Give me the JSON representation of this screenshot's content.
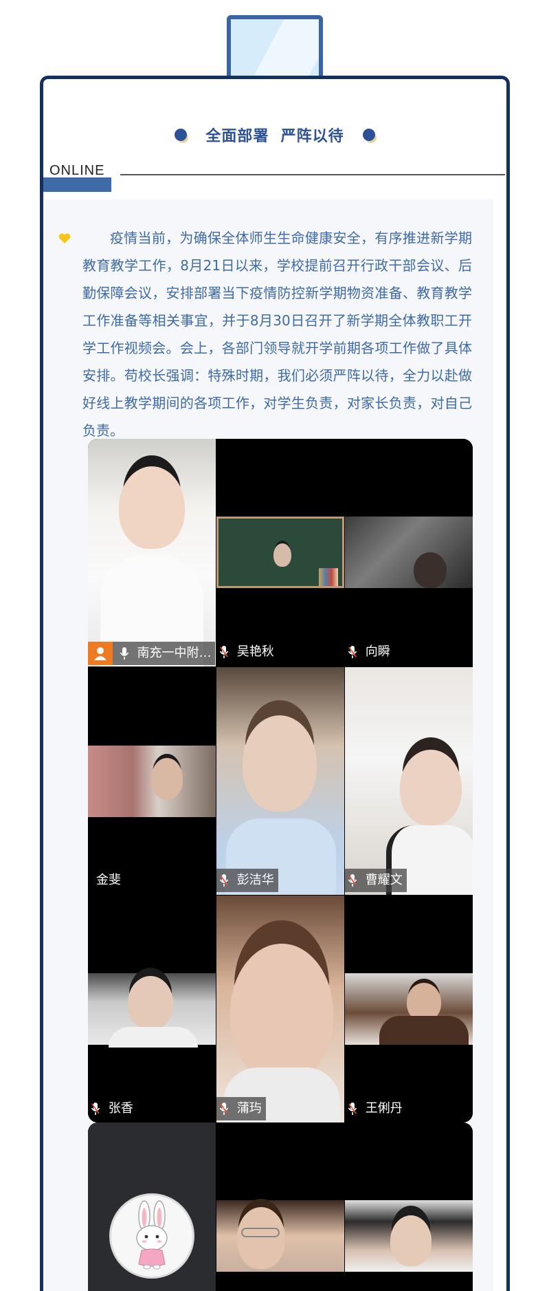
{
  "header": {
    "title": "全面部署  严阵以待",
    "section_label": "ONLINE"
  },
  "article": {
    "paragraph": "疫情当前，为确保全体师生生命健康安全，有序推进新学期教育教学工作，8月21日以来，学校提前召开行政干部会议、后勤保障会议，安排部署当下疫情防控新学期物资准备、教育教学工作准备等相关事宜，并于8月30日召开了新学期全体教职工开学工作视频会。会上，各部门领导就开学前期各项工作做了具体安排。苟校长强调：特殊时期，我们必须严阵以待，全力以赴做好线上教学期间的各项工作，对学生负责，对家长负责，对自己负责。"
  },
  "video_grid": {
    "participants": [
      {
        "name": "南充一中附…",
        "host": true,
        "mic": true
      },
      {
        "name": "吴艳秋",
        "mic": true
      },
      {
        "name": "向瞬",
        "mic": true
      },
      {
        "name": "金斐",
        "mic": false
      },
      {
        "name": "彭洁华",
        "mic": true
      },
      {
        "name": "曹耀文",
        "mic": true
      },
      {
        "name": "张香",
        "mic": true
      },
      {
        "name": "蒲玙",
        "mic": true
      },
      {
        "name": "王俐丹",
        "mic": true
      }
    ]
  },
  "colors": {
    "accent": "#3f6aa8",
    "frame": "#15305e",
    "heart": "#f5c518",
    "host_badge": "#ee7a22"
  },
  "icons": [
    "laptop-icon",
    "heart-icon",
    "mic-icon",
    "host-icon",
    "bunny-avatar-icon"
  ]
}
